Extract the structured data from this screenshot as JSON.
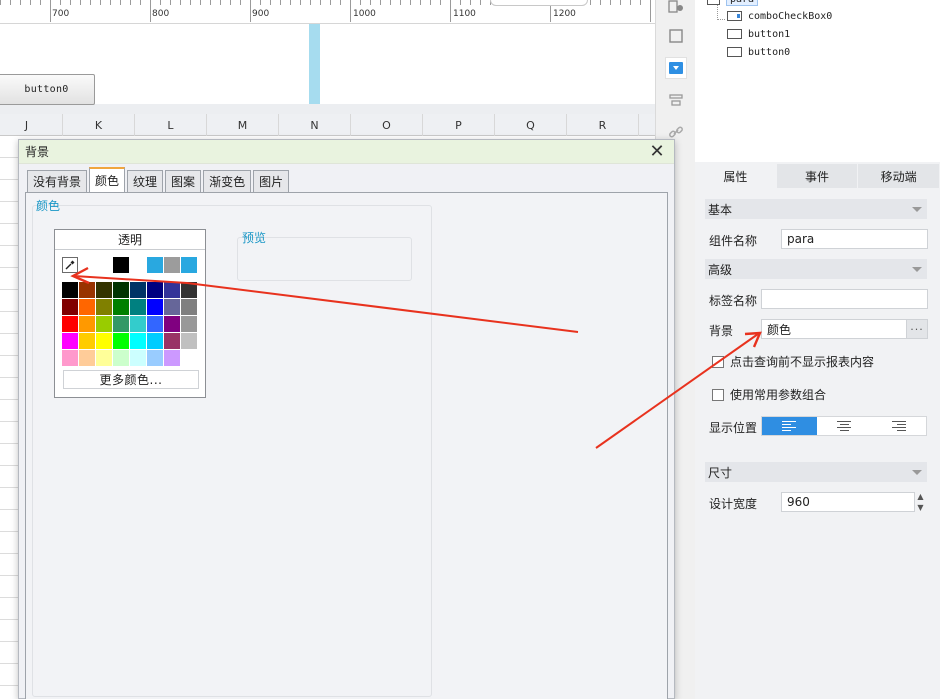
{
  "ruler": {
    "ticks": [
      "700",
      "800",
      "900",
      "1000",
      "1100",
      "1200"
    ]
  },
  "canvas": {
    "button0_label": "button0"
  },
  "sheet": {
    "columns": [
      "J",
      "K",
      "L",
      "M",
      "N",
      "O",
      "P",
      "Q",
      "R"
    ]
  },
  "tree": {
    "root": "para",
    "items": [
      {
        "label": "comboCheckBox0",
        "icon": "combobox-icon"
      },
      {
        "label": "button1",
        "icon": "button-icon"
      },
      {
        "label": "button0",
        "icon": "button-icon"
      }
    ]
  },
  "panel": {
    "tabs": [
      "属性",
      "事件",
      "移动端"
    ],
    "basic_section": "基本",
    "component_name_label": "组件名称",
    "component_name_value": "para",
    "advanced_section": "高级",
    "tag_name_label": "标签名称",
    "tag_name_value": "",
    "background_label": "背景",
    "background_value": "颜色",
    "background_more": "···",
    "check_hide_label": "点击查询前不显示报表内容",
    "check_common_label": "使用常用参数组合",
    "display_position_label": "显示位置",
    "size_section": "尺寸",
    "design_width_label": "设计宽度",
    "design_width_value": "960"
  },
  "dialog": {
    "title": "背景",
    "close": "✕",
    "tabs": [
      "没有背景",
      "颜色",
      "纹理",
      "图案",
      "渐变色",
      "图片"
    ],
    "active_tab": "颜色",
    "color_section_title": "颜色",
    "transparent_label": "透明",
    "more_colors_label": "更多颜色...",
    "preview_title": "预览",
    "recent_colors": [
      "#ffffff",
      "#000000",
      "#ffffff",
      "#29a8e0",
      "#9c9c9c",
      "#29a8e0"
    ],
    "palette_rows": [
      [
        "#000000",
        "#993300",
        "#333300",
        "#003300",
        "#003366",
        "#000080",
        "#333399",
        "#333333"
      ],
      [
        "#800000",
        "#ff6600",
        "#808000",
        "#008000",
        "#008080",
        "#0000ff",
        "#666699",
        "#808080"
      ],
      [
        "#ff0000",
        "#ff9900",
        "#99cc00",
        "#339966",
        "#33cccc",
        "#3366ff",
        "#800080",
        "#999999"
      ],
      [
        "#ff00ff",
        "#ffcc00",
        "#ffff00",
        "#00ff00",
        "#00ffff",
        "#00ccff",
        "#993366",
        "#c0c0c0"
      ],
      [
        "#ff99cc",
        "#ffcc99",
        "#ffff99",
        "#ccffcc",
        "#ccffff",
        "#99ccff",
        "#cc99ff",
        "#ffffff"
      ]
    ]
  },
  "colors": {
    "accent": "#2f8ee2",
    "section_title": "#1a97c6",
    "annotation_arrow": "#e8321e",
    "dialog_title_bg": "#e9f3df"
  }
}
